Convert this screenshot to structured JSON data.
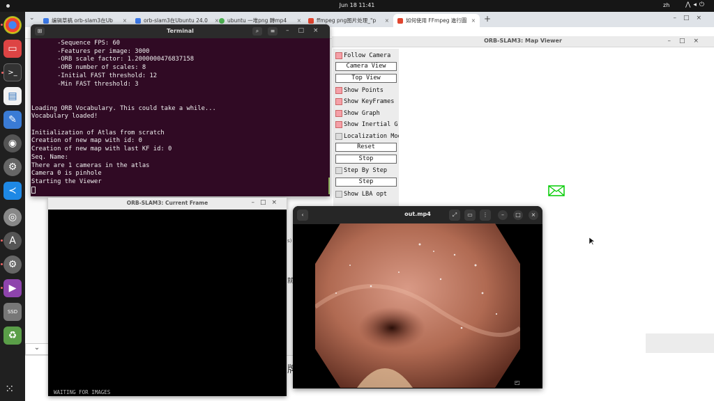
{
  "topbar": {
    "datetime": "Jun 18  11:41",
    "language": "zh",
    "tray_icons": [
      "network-icon",
      "volume-icon",
      "power-icon"
    ]
  },
  "dock": {
    "items": [
      "chrome-icon",
      "files-icon",
      "terminal-icon",
      "libreoffice-icon",
      "text-editor-icon",
      "eye-app-icon",
      "settings-gear-icon",
      "vscode-icon",
      "disk-icon",
      "software-icon",
      "settings-icon",
      "media-player-icon",
      "ssd-icon",
      "trash-icon"
    ],
    "ssd_label": "SSD"
  },
  "browser": {
    "tabs": [
      {
        "label": "编辑草稿 orb-slam3在Ub",
        "favicon": "#3b78e7"
      },
      {
        "label": "orb-slam3在Ubuntu 24.0",
        "favicon": "#3b78e7"
      },
      {
        "label": "ubuntu 一堆png 轉mp4",
        "favicon": "#4caf50"
      },
      {
        "label": "ffmpeg png图片处理_\"p",
        "favicon": "#e0452f"
      },
      {
        "label": "如何使用 FFmpeg 進行圖",
        "favicon": "#e0452f",
        "active": true
      }
    ],
    "new_tab": "+",
    "scroll_down_glyph": "⌄"
  },
  "terminal": {
    "title": "Terminal",
    "lines": [
      "       -Sequence FPS: 60",
      "       -Features per image: 3000",
      "       -ORB scale factor: 1.2000000476837158",
      "       -ORB number of scales: 8",
      "       -Initial FAST threshold: 12",
      "       -Min FAST threshold: 3",
      "",
      "",
      "Loading ORB Vocabulary. This could take a while...",
      "Vocabulary loaded!",
      "",
      "Initialization of Atlas from scratch",
      "Creation of new map with id: 0",
      "Creation of new map with last KF id: 0",
      "Seq. Name:",
      "There are 1 cameras in the atlas",
      "Camera 0 is pinhole",
      "Starting the Viewer"
    ]
  },
  "map_viewer": {
    "title": "ORB-SLAM3: Map Viewer",
    "controls": {
      "follow_camera": "Follow Camera",
      "camera_view": "Camera View",
      "top_view": "Top View",
      "show_points": "Show Points",
      "show_keyframes": "Show KeyFrames",
      "show_graph": "Show Graph",
      "show_inertial_graph": "Show Inertial Graph",
      "localization_mode": "Localization Mode",
      "reset": "Reset",
      "stop": "Stop",
      "step_by_step": "Step By Step",
      "step": "Step",
      "show_lba_opt": "Show LBA opt"
    },
    "checked": {
      "follow_camera": true,
      "show_points": true,
      "show_keyframes": true,
      "show_graph": true,
      "show_inertial_graph": true,
      "localization_mode": false,
      "step_by_step": false,
      "show_lba_opt": false
    },
    "camera_color": "#00cc00"
  },
  "current_frame": {
    "title": "ORB-SLAM3: Current Frame",
    "status": "WAITING FOR IMAGES"
  },
  "video_player": {
    "title": "out.mp4"
  }
}
